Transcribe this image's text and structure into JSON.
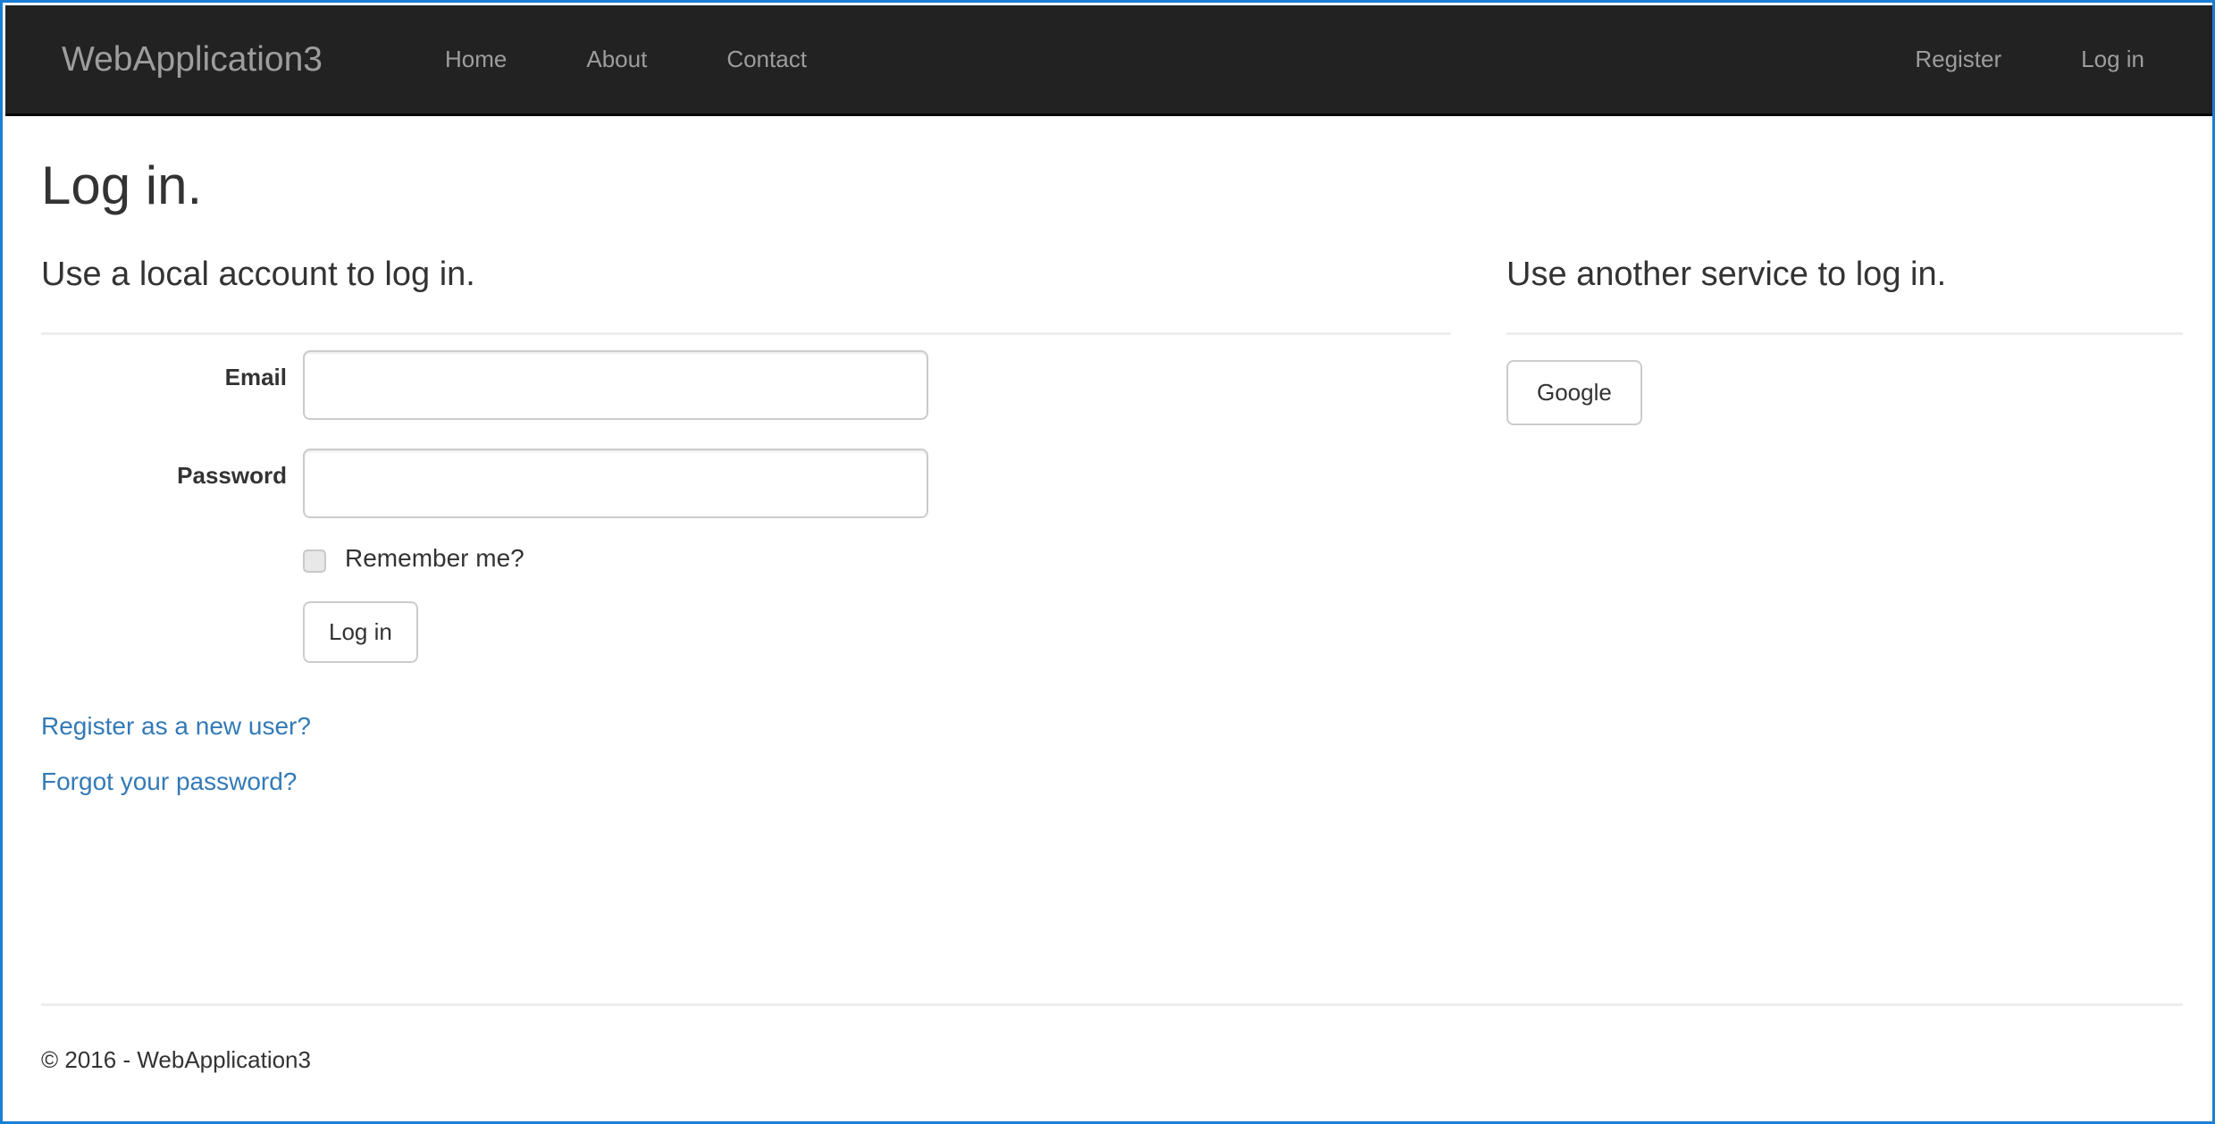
{
  "browser": {
    "frame_color": "#1a7fd4"
  },
  "navbar": {
    "brand": "WebApplication3",
    "background": "#222222",
    "link_color": "#9d9d9d",
    "left_links": [
      {
        "label": "Home",
        "name": "nav-link-home"
      },
      {
        "label": "About",
        "name": "nav-link-about"
      },
      {
        "label": "Contact",
        "name": "nav-link-contact"
      }
    ],
    "right_links": [
      {
        "label": "Register",
        "name": "nav-link-register"
      },
      {
        "label": "Log in",
        "name": "nav-link-login"
      }
    ]
  },
  "page": {
    "title": "Log in."
  },
  "local_login": {
    "heading": "Use a local account to log in.",
    "fields": [
      {
        "label": "Email",
        "value": "",
        "placeholder": ""
      },
      {
        "label": "Password",
        "value": "",
        "placeholder": ""
      }
    ],
    "remember_me": {
      "label": "Remember me?",
      "checked": false
    },
    "submit_label": "Log in",
    "links": [
      {
        "label": "Register as a new user?",
        "name": "register-new-user-link"
      },
      {
        "label": "Forgot your password?",
        "name": "forgot-password-link"
      }
    ],
    "link_color": "#337ab7"
  },
  "external_login": {
    "heading": "Use another service to log in.",
    "providers": [
      {
        "label": "Google",
        "name": "external-provider-google"
      }
    ]
  },
  "footer": {
    "text": "© 2016 - WebApplication3"
  }
}
